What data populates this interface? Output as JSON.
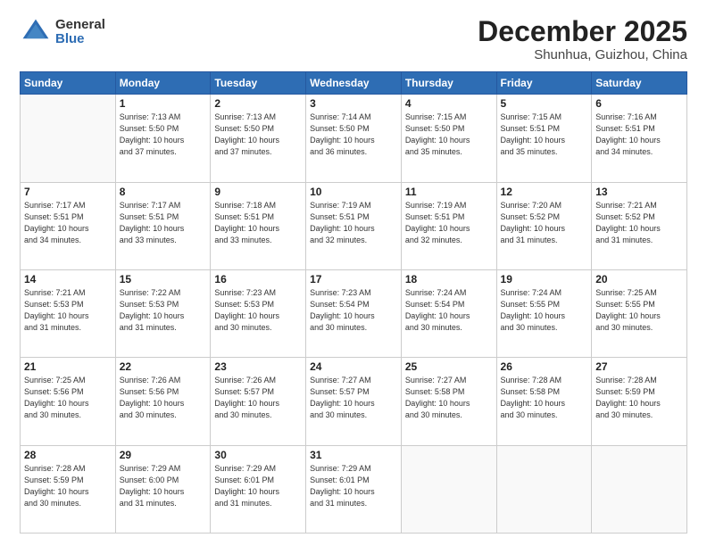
{
  "logo": {
    "general": "General",
    "blue": "Blue"
  },
  "header": {
    "month": "December 2025",
    "location": "Shunhua, Guizhou, China"
  },
  "days_of_week": [
    "Sunday",
    "Monday",
    "Tuesday",
    "Wednesday",
    "Thursday",
    "Friday",
    "Saturday"
  ],
  "weeks": [
    [
      {
        "day": "",
        "info": ""
      },
      {
        "day": "1",
        "info": "Sunrise: 7:13 AM\nSunset: 5:50 PM\nDaylight: 10 hours\nand 37 minutes."
      },
      {
        "day": "2",
        "info": "Sunrise: 7:13 AM\nSunset: 5:50 PM\nDaylight: 10 hours\nand 37 minutes."
      },
      {
        "day": "3",
        "info": "Sunrise: 7:14 AM\nSunset: 5:50 PM\nDaylight: 10 hours\nand 36 minutes."
      },
      {
        "day": "4",
        "info": "Sunrise: 7:15 AM\nSunset: 5:50 PM\nDaylight: 10 hours\nand 35 minutes."
      },
      {
        "day": "5",
        "info": "Sunrise: 7:15 AM\nSunset: 5:51 PM\nDaylight: 10 hours\nand 35 minutes."
      },
      {
        "day": "6",
        "info": "Sunrise: 7:16 AM\nSunset: 5:51 PM\nDaylight: 10 hours\nand 34 minutes."
      }
    ],
    [
      {
        "day": "7",
        "info": "Sunrise: 7:17 AM\nSunset: 5:51 PM\nDaylight: 10 hours\nand 34 minutes."
      },
      {
        "day": "8",
        "info": "Sunrise: 7:17 AM\nSunset: 5:51 PM\nDaylight: 10 hours\nand 33 minutes."
      },
      {
        "day": "9",
        "info": "Sunrise: 7:18 AM\nSunset: 5:51 PM\nDaylight: 10 hours\nand 33 minutes."
      },
      {
        "day": "10",
        "info": "Sunrise: 7:19 AM\nSunset: 5:51 PM\nDaylight: 10 hours\nand 32 minutes."
      },
      {
        "day": "11",
        "info": "Sunrise: 7:19 AM\nSunset: 5:51 PM\nDaylight: 10 hours\nand 32 minutes."
      },
      {
        "day": "12",
        "info": "Sunrise: 7:20 AM\nSunset: 5:52 PM\nDaylight: 10 hours\nand 31 minutes."
      },
      {
        "day": "13",
        "info": "Sunrise: 7:21 AM\nSunset: 5:52 PM\nDaylight: 10 hours\nand 31 minutes."
      }
    ],
    [
      {
        "day": "14",
        "info": "Sunrise: 7:21 AM\nSunset: 5:53 PM\nDaylight: 10 hours\nand 31 minutes."
      },
      {
        "day": "15",
        "info": "Sunrise: 7:22 AM\nSunset: 5:53 PM\nDaylight: 10 hours\nand 31 minutes."
      },
      {
        "day": "16",
        "info": "Sunrise: 7:23 AM\nSunset: 5:53 PM\nDaylight: 10 hours\nand 30 minutes."
      },
      {
        "day": "17",
        "info": "Sunrise: 7:23 AM\nSunset: 5:54 PM\nDaylight: 10 hours\nand 30 minutes."
      },
      {
        "day": "18",
        "info": "Sunrise: 7:24 AM\nSunset: 5:54 PM\nDaylight: 10 hours\nand 30 minutes."
      },
      {
        "day": "19",
        "info": "Sunrise: 7:24 AM\nSunset: 5:55 PM\nDaylight: 10 hours\nand 30 minutes."
      },
      {
        "day": "20",
        "info": "Sunrise: 7:25 AM\nSunset: 5:55 PM\nDaylight: 10 hours\nand 30 minutes."
      }
    ],
    [
      {
        "day": "21",
        "info": "Sunrise: 7:25 AM\nSunset: 5:56 PM\nDaylight: 10 hours\nand 30 minutes."
      },
      {
        "day": "22",
        "info": "Sunrise: 7:26 AM\nSunset: 5:56 PM\nDaylight: 10 hours\nand 30 minutes."
      },
      {
        "day": "23",
        "info": "Sunrise: 7:26 AM\nSunset: 5:57 PM\nDaylight: 10 hours\nand 30 minutes."
      },
      {
        "day": "24",
        "info": "Sunrise: 7:27 AM\nSunset: 5:57 PM\nDaylight: 10 hours\nand 30 minutes."
      },
      {
        "day": "25",
        "info": "Sunrise: 7:27 AM\nSunset: 5:58 PM\nDaylight: 10 hours\nand 30 minutes."
      },
      {
        "day": "26",
        "info": "Sunrise: 7:28 AM\nSunset: 5:58 PM\nDaylight: 10 hours\nand 30 minutes."
      },
      {
        "day": "27",
        "info": "Sunrise: 7:28 AM\nSunset: 5:59 PM\nDaylight: 10 hours\nand 30 minutes."
      }
    ],
    [
      {
        "day": "28",
        "info": "Sunrise: 7:28 AM\nSunset: 5:59 PM\nDaylight: 10 hours\nand 30 minutes."
      },
      {
        "day": "29",
        "info": "Sunrise: 7:29 AM\nSunset: 6:00 PM\nDaylight: 10 hours\nand 31 minutes."
      },
      {
        "day": "30",
        "info": "Sunrise: 7:29 AM\nSunset: 6:01 PM\nDaylight: 10 hours\nand 31 minutes."
      },
      {
        "day": "31",
        "info": "Sunrise: 7:29 AM\nSunset: 6:01 PM\nDaylight: 10 hours\nand 31 minutes."
      },
      {
        "day": "",
        "info": ""
      },
      {
        "day": "",
        "info": ""
      },
      {
        "day": "",
        "info": ""
      }
    ]
  ]
}
